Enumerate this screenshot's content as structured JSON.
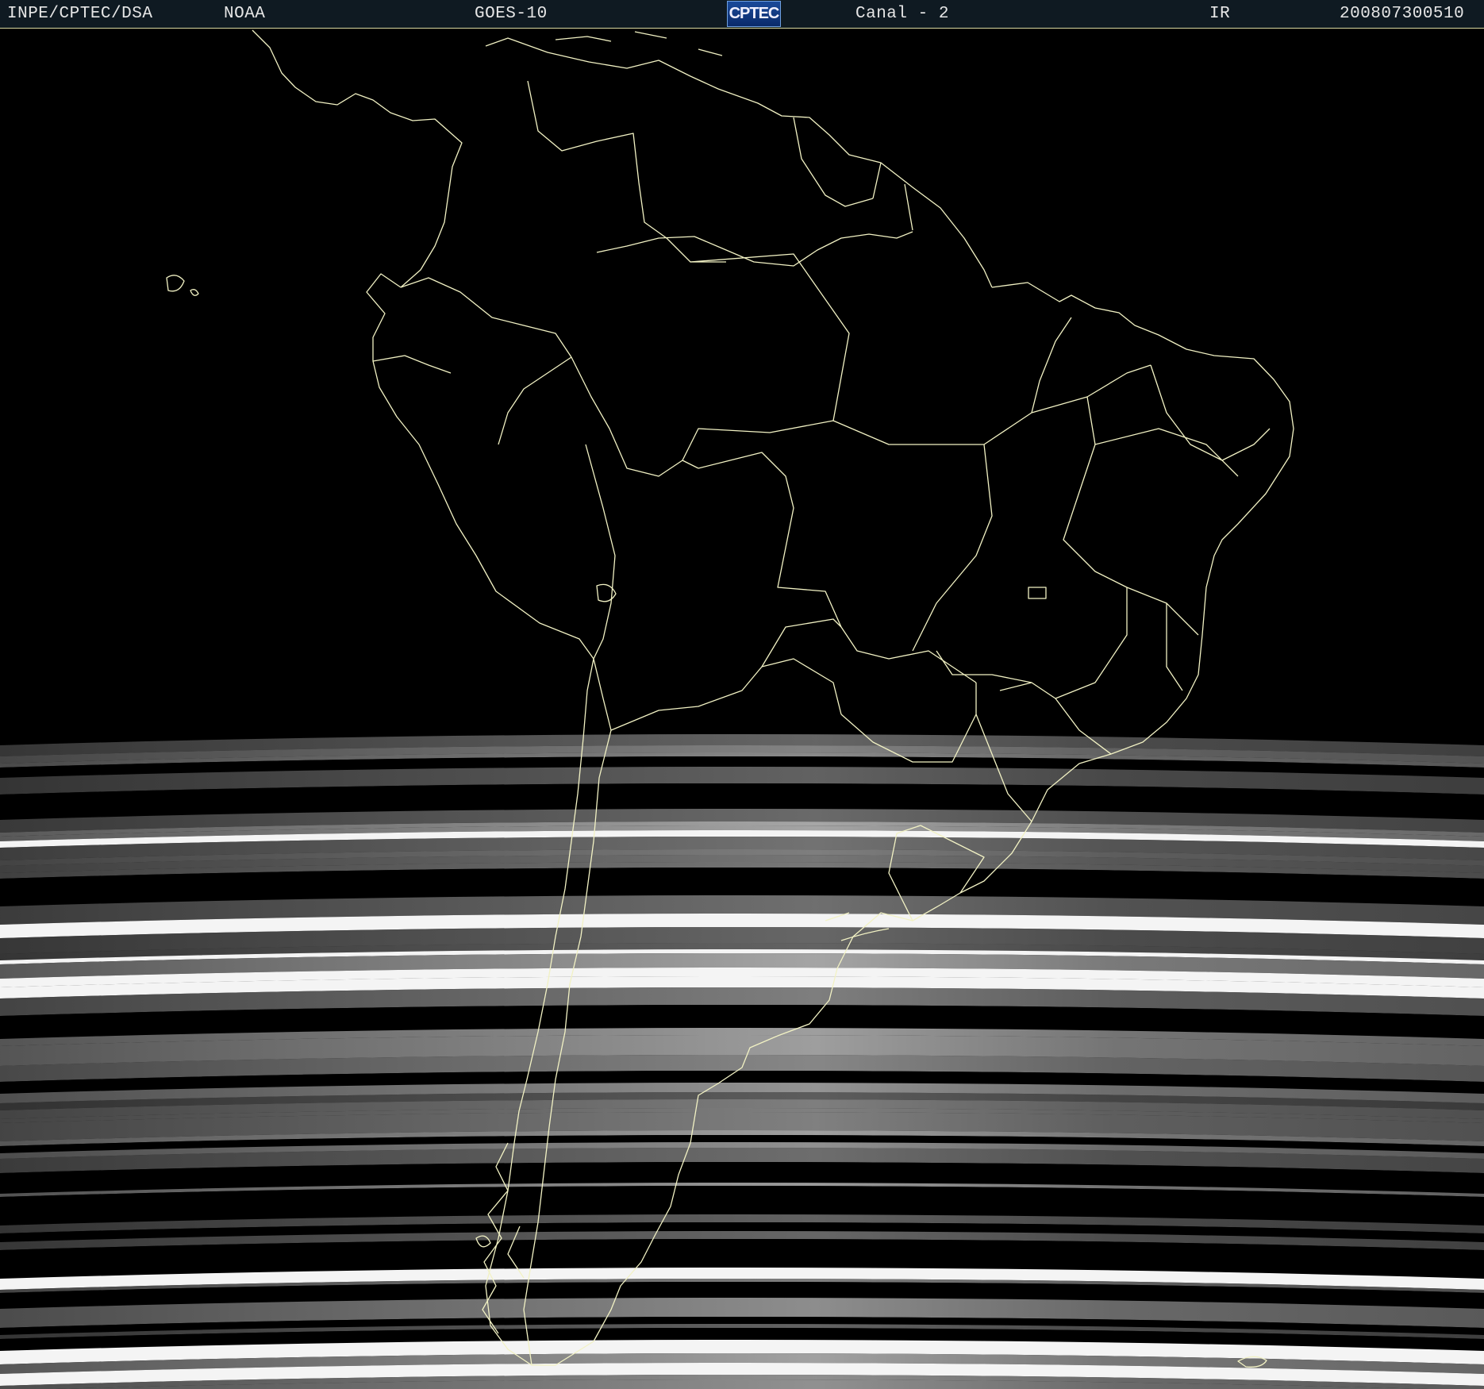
{
  "header": {
    "agency": "INPE/CPTEC/DSA",
    "source": "NOAA",
    "satellite": "GOES-10",
    "logo_text": "CPTEC",
    "channel": "Canal - 2",
    "band": "IR",
    "timestamp": "200807300510"
  },
  "map": {
    "region": "South America",
    "background_color": "#000000",
    "boundary_color": "#f4f4c0",
    "imagery": "partial infrared scan lines (grayscale) over southern South America"
  }
}
